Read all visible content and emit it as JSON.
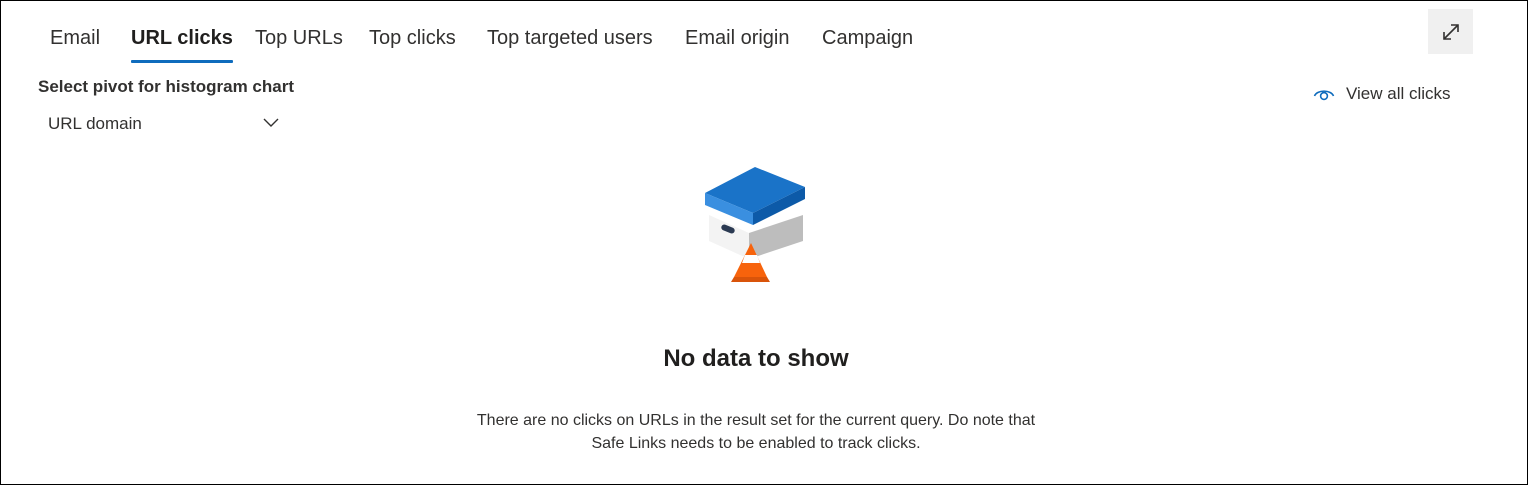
{
  "tabs": [
    {
      "label": "Email",
      "active": false
    },
    {
      "label": "URL clicks",
      "active": true
    },
    {
      "label": "Top URLs",
      "active": false
    },
    {
      "label": "Top clicks",
      "active": false
    },
    {
      "label": "Top targeted users",
      "active": false
    },
    {
      "label": "Email origin",
      "active": false
    },
    {
      "label": "Campaign",
      "active": false
    }
  ],
  "toolbar": {
    "expand_icon": "expand-icon"
  },
  "pivot": {
    "label": "Select pivot for histogram chart",
    "selected": "URL domain",
    "chevron_icon": "chevron-down-icon"
  },
  "view_all": {
    "label": "View all clicks",
    "icon": "eye-icon"
  },
  "empty_state": {
    "illustration": "box-with-traffic-cone",
    "title": "No data to show",
    "message_line1": "There are no clicks on URLs in the result set for the current query. Do note that",
    "message_line2": "Safe Links needs to be enabled to track clicks."
  },
  "colors": {
    "accent": "#0f6cbd",
    "box_lid": "#1a73c8",
    "cone": "#f7630c"
  }
}
